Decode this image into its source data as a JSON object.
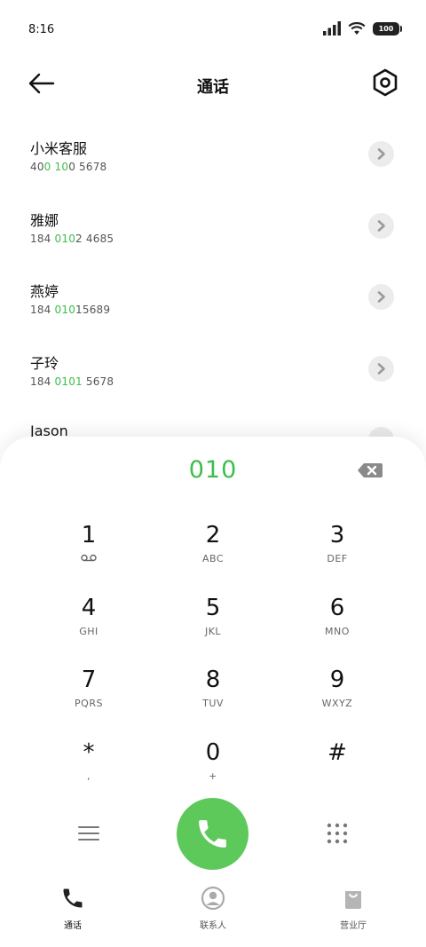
{
  "status_bar": {
    "time": "8:16",
    "battery": "100"
  },
  "header": {
    "title": "通话"
  },
  "contacts": [
    {
      "name": "小米客服",
      "number_parts": [
        "40",
        "0",
        " ",
        "10",
        "0  5678"
      ]
    },
    {
      "name": "雅娜",
      "number_parts": [
        "184  ",
        "010",
        "2  4685"
      ]
    },
    {
      "name": "燕婷",
      "number_parts": [
        "184  ",
        "010",
        "15689"
      ]
    },
    {
      "name": "子玲",
      "number_parts": [
        "184  ",
        "0101",
        "  5678"
      ]
    },
    {
      "name": "Jason",
      "number_parts": []
    }
  ],
  "dialer": {
    "input": "010",
    "keys": [
      {
        "digit": "1",
        "sub": ""
      },
      {
        "digit": "2",
        "sub": "ABC"
      },
      {
        "digit": "3",
        "sub": "DEF"
      },
      {
        "digit": "4",
        "sub": "GHI"
      },
      {
        "digit": "5",
        "sub": "JKL"
      },
      {
        "digit": "6",
        "sub": "MNO"
      },
      {
        "digit": "7",
        "sub": "PQRS"
      },
      {
        "digit": "8",
        "sub": "TUV"
      },
      {
        "digit": "9",
        "sub": "WXYZ"
      },
      {
        "digit": "*",
        "sub": ","
      },
      {
        "digit": "0",
        "sub": "+"
      },
      {
        "digit": "#",
        "sub": ""
      }
    ]
  },
  "nav": {
    "calls": "通话",
    "contacts": "联系人",
    "store": "营业厅"
  },
  "colors": {
    "accent": "#3cbf4a",
    "call_button": "#5cc95a"
  }
}
